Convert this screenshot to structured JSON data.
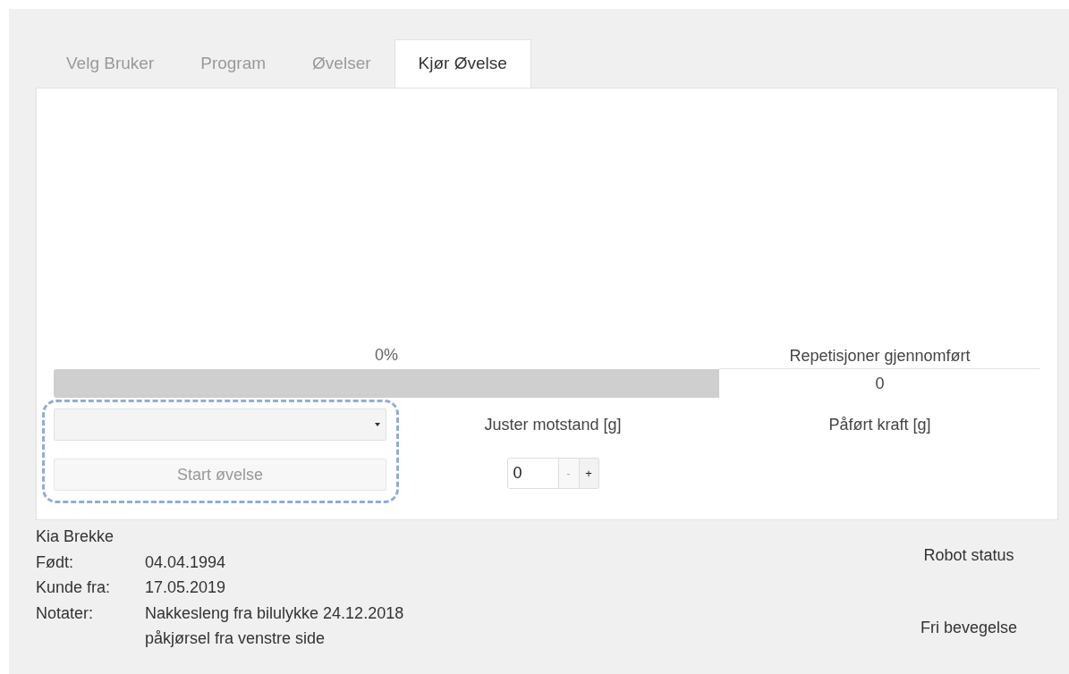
{
  "tabs": [
    {
      "label": "Velg Bruker",
      "selected": false
    },
    {
      "label": "Program",
      "selected": false
    },
    {
      "label": "Øvelser",
      "selected": false
    },
    {
      "label": "Kjør Øvelse",
      "selected": true
    }
  ],
  "progress": {
    "reading": "0%",
    "level": 0
  },
  "exercise_select": {
    "disabled": false
  },
  "start_button": {
    "label": "Start øvelse",
    "disabled": true
  },
  "resistance": {
    "label": "Juster motstand [g]",
    "value": "0",
    "decrement": "-",
    "increment": "+"
  },
  "repetitions": {
    "heading": "Repetisjoner gjennomført",
    "value": "0"
  },
  "applied_force": {
    "label": "Påført kraft [g]"
  },
  "user": {
    "name": "Kia Brekke",
    "fields": [
      {
        "label": "Født:",
        "value": "04.04.1994"
      },
      {
        "label": "Kunde fra:",
        "value": "17.05.2019"
      },
      {
        "label": "Notater:",
        "value": "Nakkesleng fra bilulykke 24.12.2018\npåkjørsel fra venstre side"
      }
    ]
  },
  "robot": {
    "status_label": "Robot status",
    "status": "Fri bevegelse"
  }
}
